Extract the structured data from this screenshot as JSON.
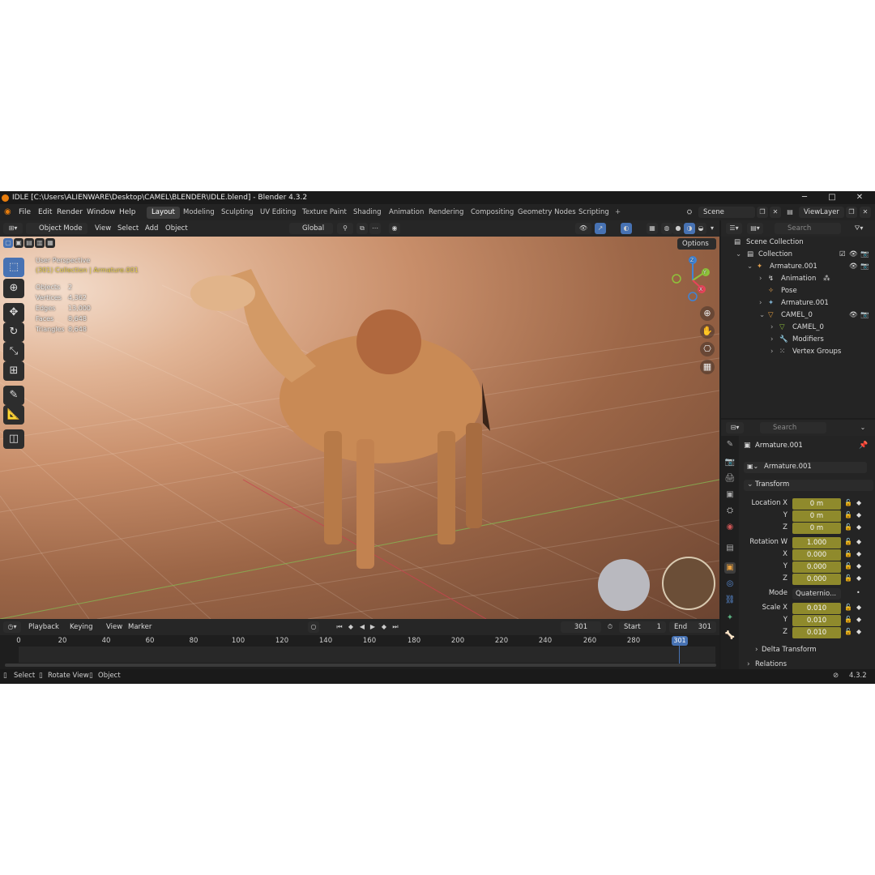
{
  "window": {
    "title": "IDLE [C:\\Users\\ALIENWARE\\Desktop\\CAMEL\\BLENDER\\IDLE.blend] - Blender 4.3.2",
    "controls": [
      "─",
      "□",
      "✕"
    ]
  },
  "menu": [
    "File",
    "Edit",
    "Render",
    "Window",
    "Help"
  ],
  "workspaces": [
    "Layout",
    "Modeling",
    "Sculpting",
    "UV Editing",
    "Texture Paint",
    "Shading",
    "Animation",
    "Rendering",
    "Compositing",
    "Geometry Nodes",
    "Scripting"
  ],
  "workspace_add": "+",
  "scene": {
    "name": "Scene",
    "view_layer": "ViewLayer"
  },
  "viewport_header": {
    "mode": "Object Mode",
    "menus": [
      "View",
      "Select",
      "Add",
      "Object"
    ],
    "orientation": "Global",
    "options": "Options"
  },
  "viewport": {
    "perspective": "User Perspective",
    "collection_info": "(301) Collection | Armature.001",
    "stats": [
      {
        "label": "Objects",
        "value": "2"
      },
      {
        "label": "Vertices",
        "value": "4,362"
      },
      {
        "label": "Edges",
        "value": "13,000"
      },
      {
        "label": "Faces",
        "value": "8,648"
      },
      {
        "label": "Triangles",
        "value": "8,648"
      }
    ],
    "gizmo": {
      "x": "X",
      "y": "Y",
      "z": "Z"
    },
    "colors": {
      "x_axis": "#e8445a",
      "y_axis": "#8fc23b",
      "z_axis": "#3f84d6",
      "accent": "#4772b3"
    }
  },
  "timeline": {
    "menus": [
      "Playback",
      "Keying",
      "View",
      "Marker"
    ],
    "current_frame": "301",
    "start_label": "Start",
    "start": "1",
    "end_label": "End",
    "end": "301",
    "ticks": [
      "0",
      "20",
      "40",
      "60",
      "80",
      "100",
      "120",
      "140",
      "160",
      "180",
      "200",
      "220",
      "240",
      "260",
      "280"
    ],
    "playhead": "301"
  },
  "status": {
    "select": "Select",
    "rotate": "Rotate View",
    "object": "Object",
    "version": "4.3.2"
  },
  "outliner": {
    "search_placeholder": "Search",
    "items": [
      {
        "label": "Scene Collection"
      },
      {
        "label": "Collection"
      },
      {
        "label": "Armature.001"
      },
      {
        "label": "Animation"
      },
      {
        "label": "Pose"
      },
      {
        "label": "Armature.001"
      },
      {
        "label": "CAMEL_0"
      },
      {
        "label": "CAMEL_0"
      },
      {
        "label": "Modifiers"
      },
      {
        "label": "Vertex Groups"
      }
    ]
  },
  "properties": {
    "search_placeholder": "Search",
    "object_name": "Armature.001",
    "data_name": "Armature.001",
    "transform_title": "Transform",
    "location": [
      {
        "label": "Location X",
        "value": "0 m"
      },
      {
        "label": "Y",
        "value": "0 m"
      },
      {
        "label": "Z",
        "value": "0 m"
      }
    ],
    "rotation": [
      {
        "label": "Rotation W",
        "value": "1.000"
      },
      {
        "label": "X",
        "value": "0.000"
      },
      {
        "label": "Y",
        "value": "0.000"
      },
      {
        "label": "Z",
        "value": "0.000"
      }
    ],
    "mode_label": "Mode",
    "mode_value": "Quaternio...",
    "scale": [
      {
        "label": "Scale X",
        "value": "0.010"
      },
      {
        "label": "Y",
        "value": "0.010"
      },
      {
        "label": "Z",
        "value": "0.010"
      }
    ],
    "delta_transform": "Delta Transform",
    "relations": "Relations"
  }
}
